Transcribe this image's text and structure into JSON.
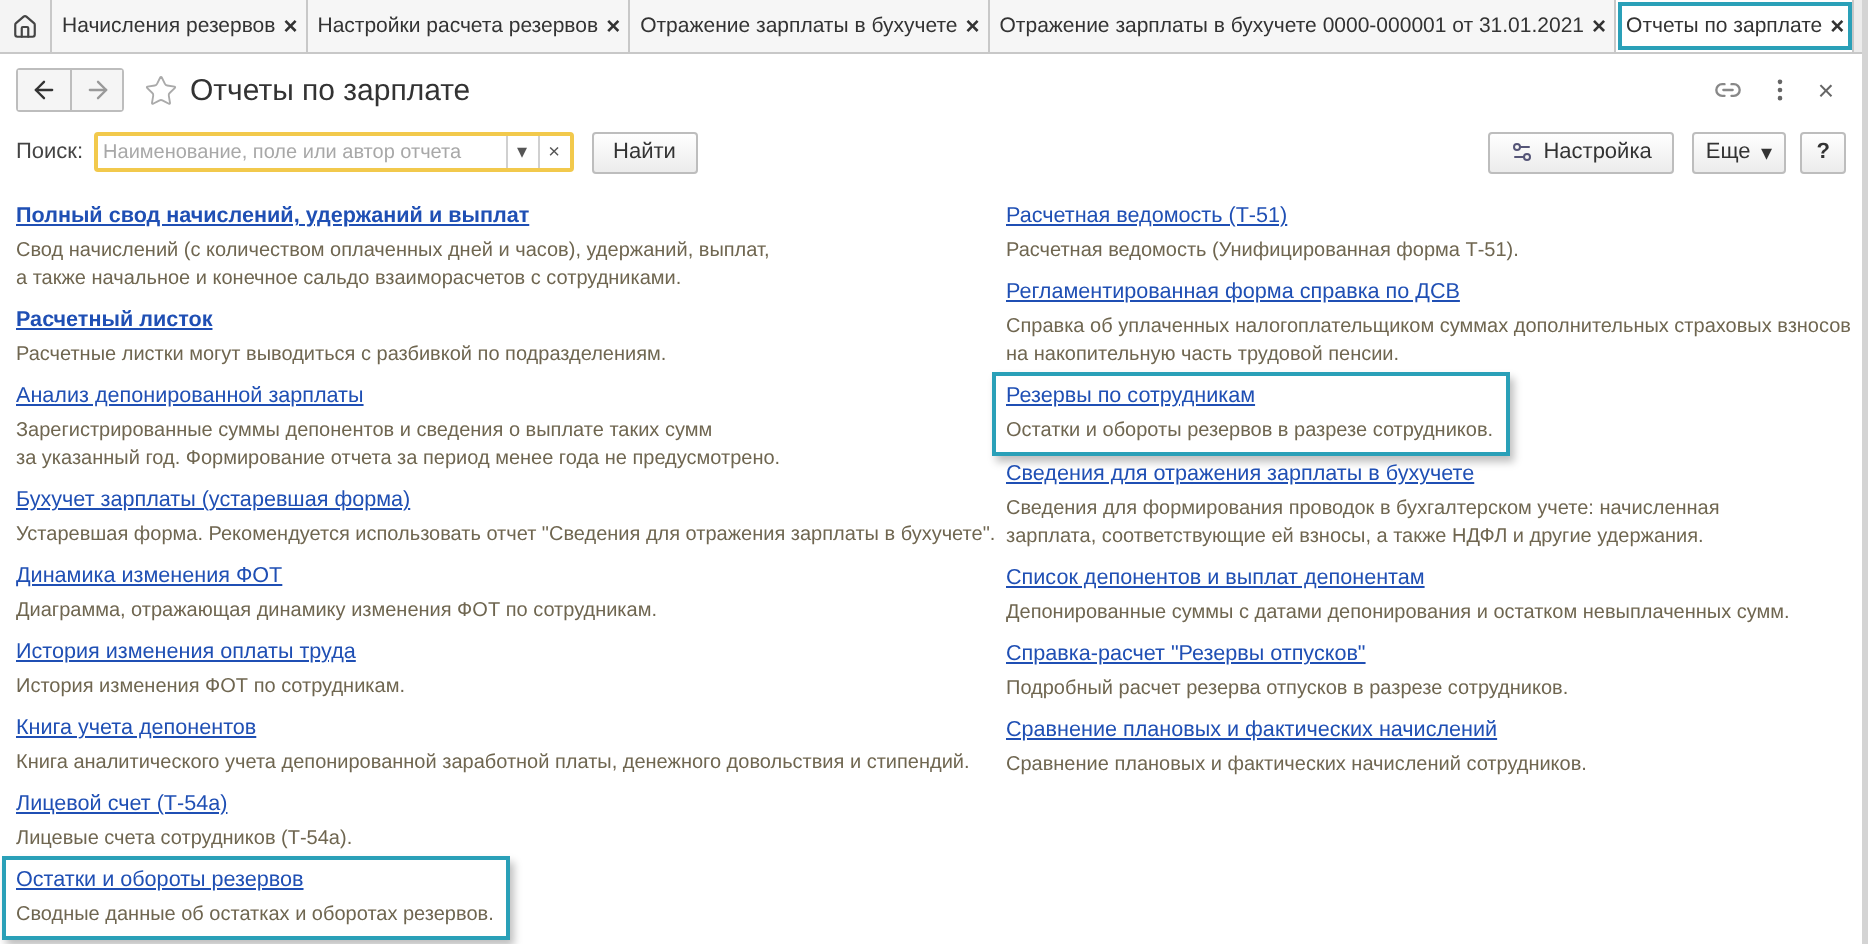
{
  "tabs": [
    {
      "label": "Начисления резервов",
      "close": "×",
      "selected": false
    },
    {
      "label": "Настройки расчета резервов",
      "close": "×",
      "selected": false
    },
    {
      "label": "Отражение зарплаты в бухучете",
      "close": "×",
      "selected": false
    },
    {
      "label": "Отражение зарплаты в бухучете 0000-000001 от 31.01.2021",
      "close": "×",
      "selected": false
    },
    {
      "label": "Отчеты по зарплате",
      "close": "×",
      "selected": true
    }
  ],
  "window": {
    "title": "Отчеты по зарплате",
    "close": "×"
  },
  "search": {
    "label": "Поиск:",
    "placeholder": "Наименование, поле или автор отчета",
    "dropdown": "▾",
    "clear": "×",
    "button": "Найти"
  },
  "toolbar": {
    "settings": "Настройка",
    "more": "Еще",
    "more_caret": "▾",
    "help": "?"
  },
  "columns": [
    [
      {
        "title": "Полный свод начислений, удержаний и выплат",
        "bold": true,
        "highlighted": false,
        "description": [
          "Свод начислений (с количеством оплаченных дней и часов), удержаний, выплат,",
          "а также начальное и конечное сальдо взаиморасчетов с сотрудниками."
        ]
      },
      {
        "title": "Расчетный листок",
        "bold": true,
        "highlighted": false,
        "description": [
          "Расчетные листки могут выводиться с разбивкой по подразделениям."
        ]
      },
      {
        "title": "Анализ депонированной зарплаты",
        "bold": false,
        "highlighted": false,
        "description": [
          "Зарегистрированные суммы депонентов и сведения о выплате таких сумм",
          "за указанный год. Формирование отчета за период менее года не предусмотрено."
        ]
      },
      {
        "title": "Бухучет зарплаты (устаревшая форма)",
        "bold": false,
        "highlighted": false,
        "description": [
          "Устаревшая форма. Рекомендуется использовать отчет \"Сведения для отражения зарплаты в бухучете\"."
        ]
      },
      {
        "title": "Динамика изменения ФОТ",
        "bold": false,
        "highlighted": false,
        "description": [
          "Диаграмма, отражающая динамику изменения ФОТ по сотрудникам."
        ]
      },
      {
        "title": "История изменения оплаты труда",
        "bold": false,
        "highlighted": false,
        "description": [
          "История изменения ФОТ по сотрудникам."
        ]
      },
      {
        "title": "Книга учета депонентов",
        "bold": false,
        "highlighted": false,
        "description": [
          "Книга аналитического учета депонированной заработной платы, денежного довольствия и стипендий."
        ]
      },
      {
        "title": "Лицевой счет (Т-54а)",
        "bold": false,
        "highlighted": false,
        "description": [
          "Лицевые счета сотрудников (Т-54а)."
        ]
      },
      {
        "title": "Остатки и обороты резервов",
        "bold": false,
        "highlighted": true,
        "description": [
          "Сводные данные об остатках и оборотах резервов."
        ]
      }
    ],
    [
      {
        "title": "Расчетная ведомость (Т-51)",
        "bold": false,
        "highlighted": false,
        "description": [
          "Расчетная ведомость (Унифицированная форма Т-51)."
        ]
      },
      {
        "title": "Регламентированная форма справка по ДСВ",
        "bold": false,
        "highlighted": false,
        "description": [
          "Справка об уплаченных налогоплательщиком суммах дополнительных страховых взносов",
          "на накопительную часть трудовой пенсии."
        ]
      },
      {
        "title": "Резервы по сотрудникам",
        "bold": false,
        "highlighted": true,
        "description": [
          "Остатки и обороты резервов в разрезе сотрудников."
        ]
      },
      {
        "title": "Сведения для отражения зарплаты в бухучете",
        "bold": false,
        "highlighted": false,
        "description": [
          "Сведения для формирования проводок в бухгалтерском учете: начисленная",
          "зарплата, соответствующие ей взносы, а также НДФЛ и другие удержания."
        ]
      },
      {
        "title": "Список депонентов и выплат депонентам",
        "bold": false,
        "highlighted": false,
        "description": [
          "Депонированные суммы с датами депонирования и остатком невыплаченных сумм."
        ]
      },
      {
        "title": "Справка-расчет \"Резервы отпусков\"",
        "bold": false,
        "highlighted": false,
        "description": [
          "Подробный расчет резерва отпусков в разрезе сотрудников."
        ]
      },
      {
        "title": "Сравнение плановых и фактических начислений",
        "bold": false,
        "highlighted": false,
        "description": [
          "Сравнение плановых и фактических начислений сотрудников."
        ]
      }
    ]
  ]
}
